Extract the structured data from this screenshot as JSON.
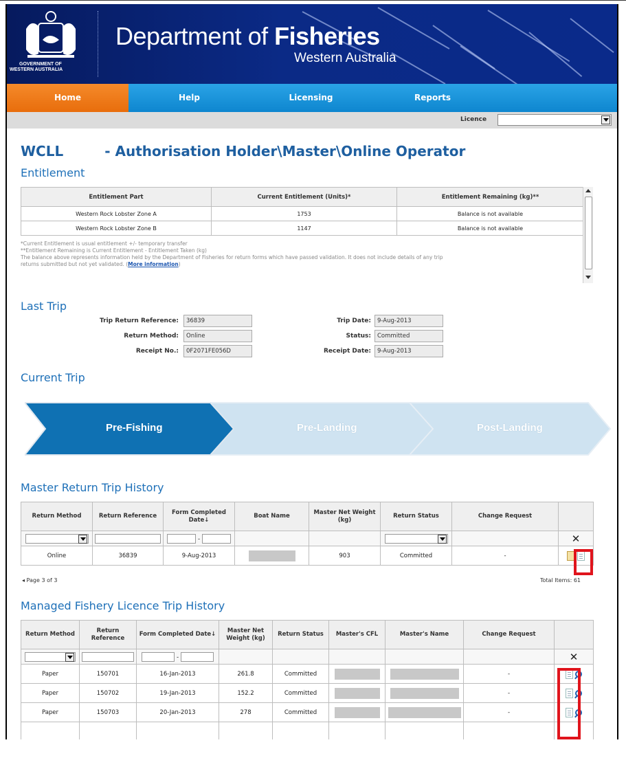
{
  "header": {
    "crest_line1": "GOVERNMENT OF",
    "crest_line2": "WESTERN AUSTRALIA",
    "title_regular": "Department of ",
    "title_bold": "Fisheries",
    "subtitle": "Western Australia"
  },
  "nav": {
    "items": [
      {
        "label": "Home",
        "active": true
      },
      {
        "label": "Help"
      },
      {
        "label": "Licensing"
      },
      {
        "label": "Reports"
      }
    ]
  },
  "licence": {
    "label": "Licence",
    "value": ""
  },
  "page": {
    "title_code": "WCLL",
    "title_rest": "- Authorisation Holder\\Master\\Online Operator"
  },
  "entitlement": {
    "heading": "Entitlement",
    "columns": [
      "Entitlement Part",
      "Current Entitlement (Units)*",
      "Entitlement Remaining (kg)**"
    ],
    "rows": [
      [
        "Western Rock Lobster Zone A",
        "1753",
        "Balance is not available"
      ],
      [
        "Western Rock Lobster Zone B",
        "1147",
        "Balance is not available"
      ]
    ],
    "note1": "*Current Entitlement is usual entitlement +/- temporary transfer",
    "note2": "**Entitlement Remaining is Current Entitlement - Entitlement Taken (kg)",
    "note3": "The balance above represents information held by the Department of Fisheries for return forms which have passed validation. It does not include details of any trip",
    "note4_pre": "returns submitted but not yet validated. (",
    "note4_link": "More information",
    "note4_post": ")"
  },
  "last_trip": {
    "heading": "Last Trip",
    "trip_return_reference_label": "Trip Return Reference:",
    "trip_return_reference": "36839",
    "return_method_label": "Return Method:",
    "return_method": "Online",
    "receipt_no_label": "Receipt No.:",
    "receipt_no": "0F2071FE056D",
    "trip_date_label": "Trip Date:",
    "trip_date": "9-Aug-2013",
    "status_label": "Status:",
    "status": "Committed",
    "receipt_date_label": "Receipt Date:",
    "receipt_date": "9-Aug-2013"
  },
  "current_trip": {
    "heading": "Current Trip",
    "steps": [
      "Pre-Fishing",
      "Pre-Landing",
      "Post-Landing"
    ],
    "active_step": 0,
    "colors": {
      "active": "#0f71b3",
      "inactive": "#cfe3f1",
      "inactive_text": "#ffffff"
    }
  },
  "master_history": {
    "heading": "Master Return Trip History",
    "columns": [
      "Return Method",
      "Return Reference",
      "Form Completed Date↓",
      "Boat Name",
      "Master Net Weight (kg)",
      "Return Status",
      "Change Request"
    ],
    "filter_date_sep": "-",
    "clear_symbol": "✕",
    "rows": [
      {
        "method": "Online",
        "reference": "36839",
        "date": "9-Aug-2013",
        "weight": "903",
        "status": "Committed",
        "change": "-"
      }
    ],
    "pager": "◂  Page 3 of 3",
    "total": "Total Items: 61"
  },
  "managed_history": {
    "heading": "Managed Fishery Licence Trip History",
    "columns": [
      "Return Method",
      "Return Reference",
      "Form Completed Date↓",
      "Master Net Weight (kg)",
      "Return Status",
      "Master's CFL",
      "Master's Name",
      "Change Request"
    ],
    "filter_date_sep": "-",
    "clear_symbol": "✕",
    "rows": [
      {
        "method": "Paper",
        "reference": "150701",
        "date": "16-Jan-2013",
        "weight": "261.8",
        "status": "Committed",
        "change": "-"
      },
      {
        "method": "Paper",
        "reference": "150702",
        "date": "19-Jan-2013",
        "weight": "152.2",
        "status": "Committed",
        "change": "-"
      },
      {
        "method": "Paper",
        "reference": "150703",
        "date": "20-Jan-2013",
        "weight": "278",
        "status": "Committed",
        "change": "-"
      }
    ]
  },
  "colors": {
    "highlight": "#e0141c",
    "heading": "#1e70b8",
    "nav": "#0e86cf",
    "nav_active": "#e86d0c"
  }
}
